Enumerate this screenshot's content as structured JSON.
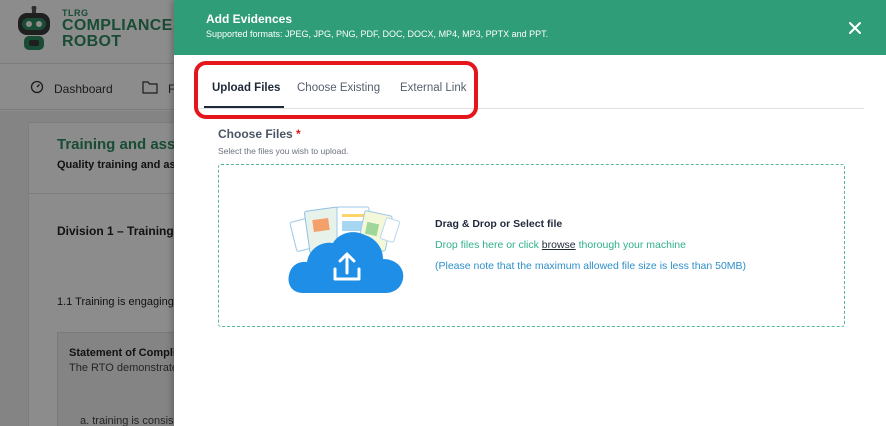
{
  "app": {
    "logo_small": "TLRG",
    "logo_line1": "COMPLIANCE",
    "logo_line2": "ROBOT"
  },
  "nav": {
    "dashboard": "Dashboard",
    "second_partial": "F"
  },
  "background": {
    "title": "Training and asse",
    "subtitle": "Quality training and asse",
    "division": "Division 1 – Training",
    "standard": "1.1 Training is engaging,",
    "statement": "Statement of Complia",
    "rto_text": "The RTO demonstrate",
    "item_a": "a. training is consis"
  },
  "drawer": {
    "title": "Add Evidences",
    "formats": "Supported formats: JPEG, JPG, PNG, PDF, DOC, DOCX, MP4, MP3, PPTX and PPT.",
    "tabs": [
      {
        "label": "Upload Files",
        "active": true
      },
      {
        "label": "Choose Existing",
        "active": false
      },
      {
        "label": "External Link",
        "active": false
      }
    ],
    "choose_label": "Choose Files",
    "required_mark": "*",
    "choose_hint": "Select the files you wish to upload.",
    "dropzone": {
      "title": "Drag & Drop or Select file",
      "line1_pre": "Drop files here or click ",
      "line1_link": "browse",
      "line1_post": " thorough your machine",
      "line2": "(Please note that the maximum allowed file size is less than 50MB)"
    }
  },
  "colors": {
    "header_green": "#2f9d77",
    "highlight_red": "#e4161b",
    "brand_green": "#2f8a62",
    "dropzone_border": "#58b88e",
    "cloud_blue": "#1e8ee6"
  },
  "icons": {
    "close": "close-icon",
    "dashboard": "dashboard-icon",
    "folder": "folder-icon",
    "upload_cloud": "upload-cloud-icon",
    "robot": "robot-logo-icon"
  }
}
